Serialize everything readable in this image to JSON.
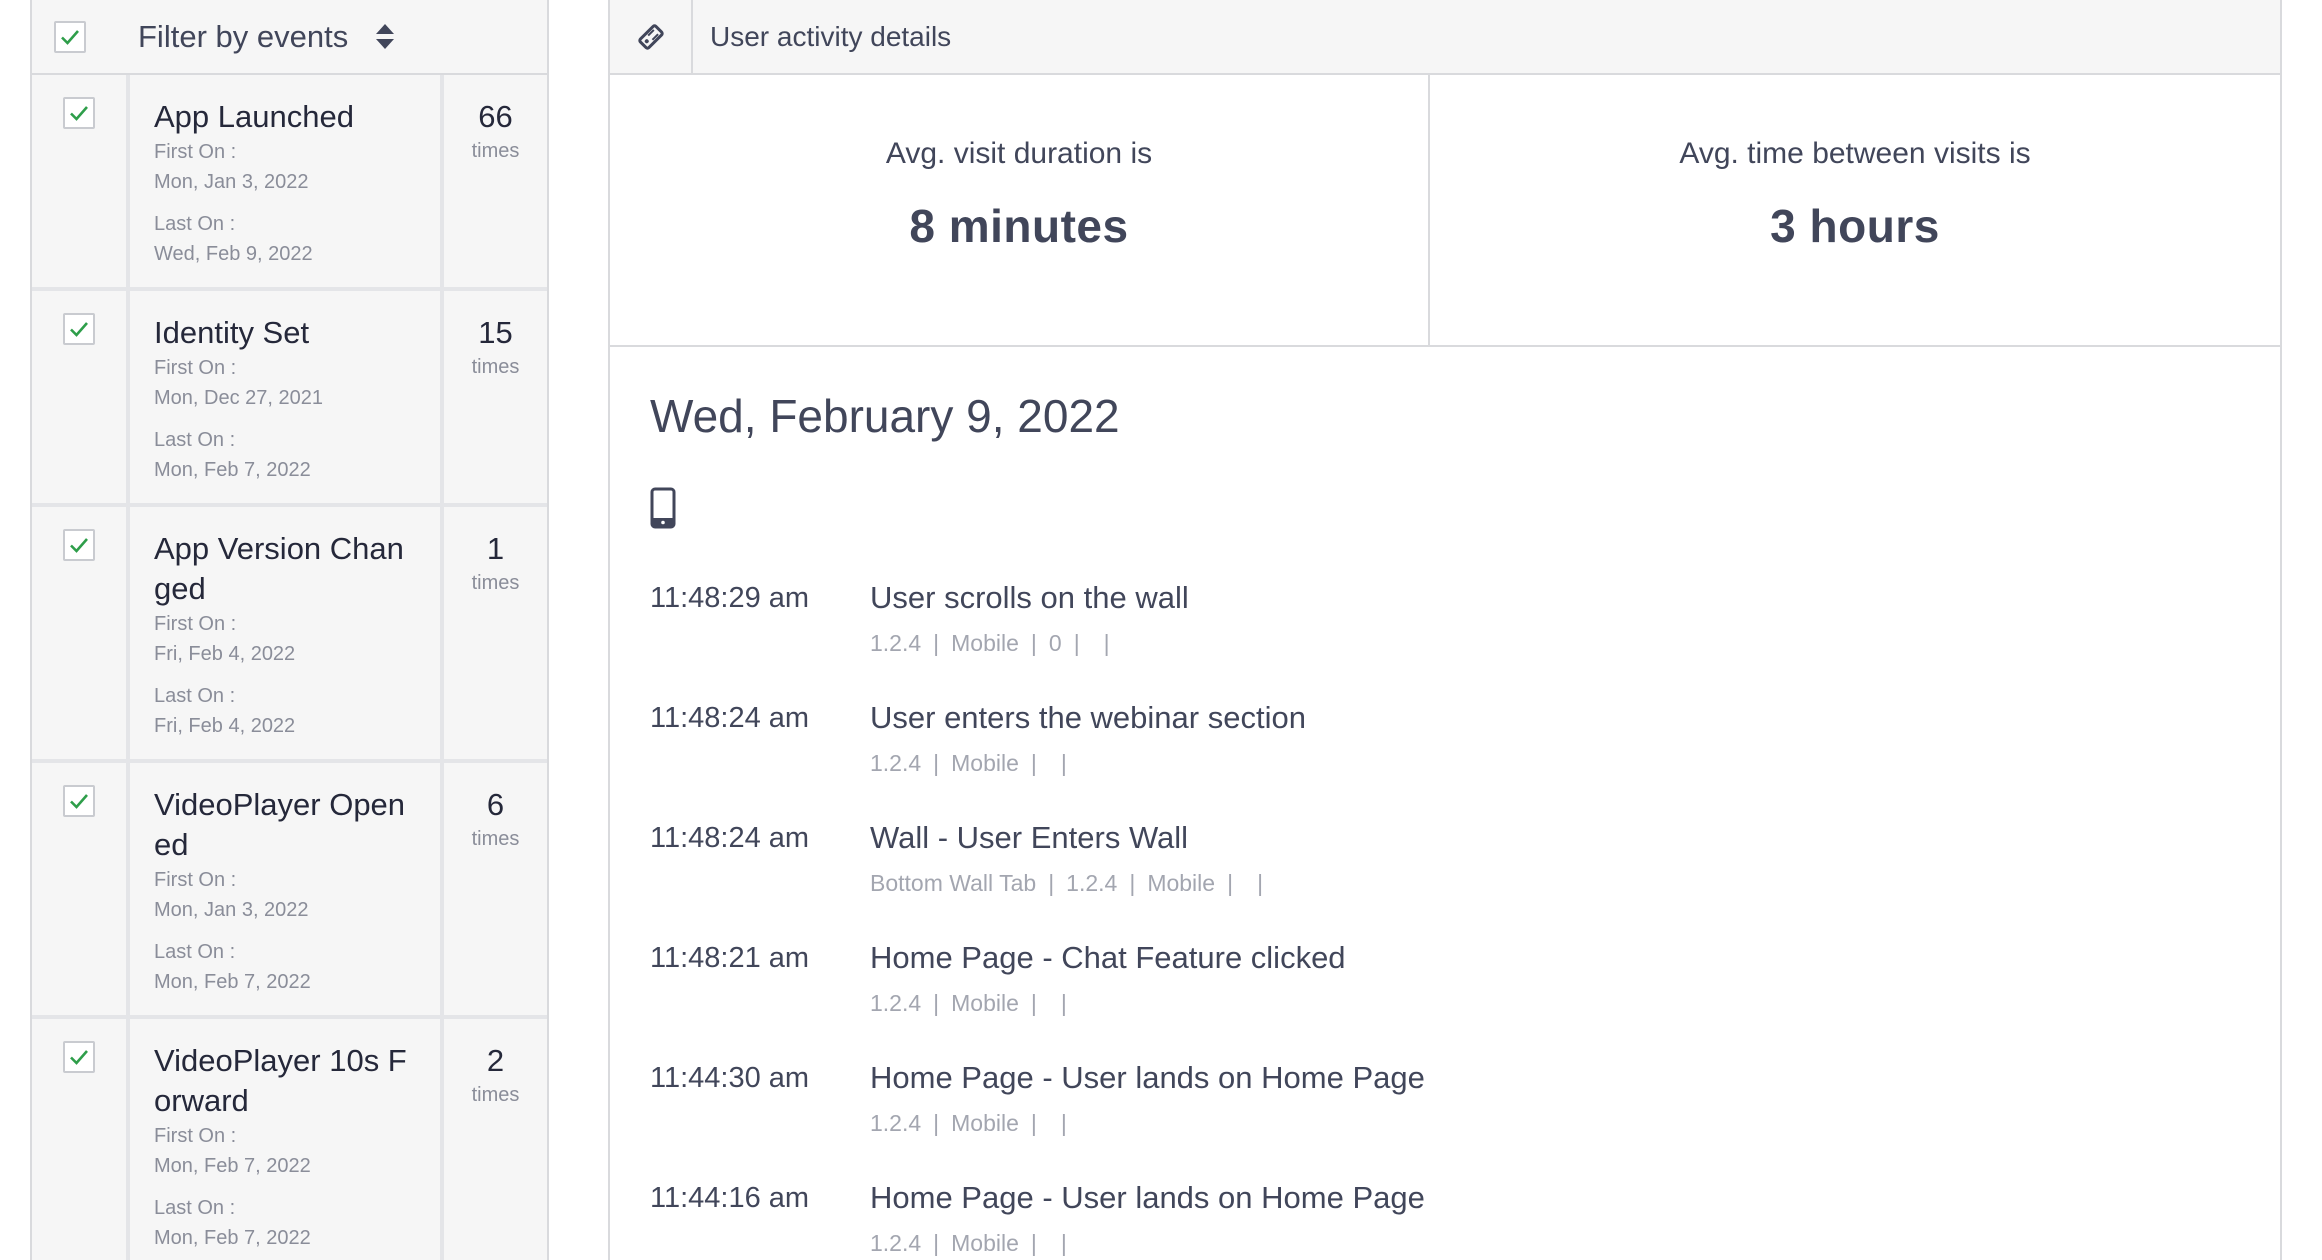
{
  "filter": {
    "title": "Filter by events"
  },
  "events": [
    {
      "name": "App Launched",
      "first_label": "First On :",
      "first": "Mon, Jan 3, 2022",
      "last_label": "Last On :",
      "last": "Wed, Feb 9, 2022",
      "count": "66",
      "unit": "times"
    },
    {
      "name": "Identity Set",
      "first_label": "First On :",
      "first": "Mon, Dec 27, 2021",
      "last_label": "Last On :",
      "last": "Mon, Feb 7, 2022",
      "count": "15",
      "unit": "times"
    },
    {
      "name": "App Version Chan ged",
      "first_label": "First On :",
      "first": "Fri, Feb 4, 2022",
      "last_label": "Last On :",
      "last": "Fri, Feb 4, 2022",
      "count": "1",
      "unit": "times"
    },
    {
      "name": "VideoPlayer Open ed",
      "first_label": "First On :",
      "first": "Mon, Jan 3, 2022",
      "last_label": "Last On :",
      "last": "Mon, Feb 7, 2022",
      "count": "6",
      "unit": "times"
    },
    {
      "name": "VideoPlayer 10s F orward",
      "first_label": "First On :",
      "first": "Mon, Feb 7, 2022",
      "last_label": "Last On :",
      "last": "Mon, Feb 7, 2022",
      "count": "2",
      "unit": "times"
    }
  ],
  "details": {
    "title": "User activity details",
    "avg_duration_label": "Avg. visit duration is",
    "avg_duration_value": "8 minutes",
    "avg_between_label": "Avg. time between visits is",
    "avg_between_value": "3 hours",
    "day": "Wed, February 9, 2022"
  },
  "activity": [
    {
      "time": "11:48:29 am",
      "event": "User scrolls on the wall",
      "meta": [
        "1.2.4",
        "Mobile",
        "0",
        ""
      ]
    },
    {
      "time": "11:48:24 am",
      "event": "User enters the webinar section",
      "meta": [
        "1.2.4",
        "Mobile",
        ""
      ]
    },
    {
      "time": "11:48:24 am",
      "event": "Wall - User Enters Wall",
      "meta": [
        "Bottom Wall Tab",
        "1.2.4",
        "Mobile",
        ""
      ]
    },
    {
      "time": "11:48:21 am",
      "event": "Home Page - Chat Feature clicked",
      "meta": [
        "1.2.4",
        "Mobile",
        ""
      ]
    },
    {
      "time": "11:44:30 am",
      "event": "Home Page - User lands on Home Page",
      "meta": [
        "1.2.4",
        "Mobile",
        ""
      ]
    },
    {
      "time": "11:44:16 am",
      "event": "Home Page - User lands on Home Page",
      "meta": [
        "1.2.4",
        "Mobile",
        ""
      ]
    }
  ],
  "colors": {
    "check": "#2e9e4a",
    "text": "#41465a",
    "muted": "#8a8d99"
  },
  "icons": {
    "header_icon": "tag-icon",
    "device_icon": "mobile-phone-icon",
    "sort_icon": "sort-icon",
    "check_icon": "checkmark-icon"
  }
}
